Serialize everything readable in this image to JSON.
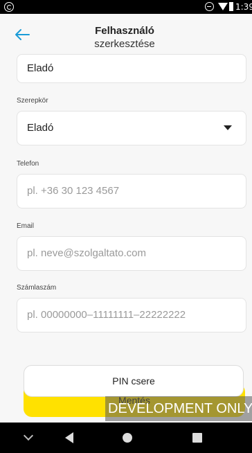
{
  "status_bar": {
    "time": "1:39",
    "icons": [
      "sync-icon",
      "do-not-disturb-icon",
      "wifi-icon",
      "battery-icon"
    ]
  },
  "header": {
    "title_line1": "Felhasználó",
    "title_line2": "szerkesztése",
    "back_icon": "arrow-left-icon",
    "accent_color": "#1a9bd7"
  },
  "form": {
    "name_value": "Eladó",
    "role": {
      "label": "Szerepkör",
      "value": "Eladó"
    },
    "phone": {
      "label": "Telefon",
      "placeholder": "pl. +36 30 123 4567"
    },
    "email": {
      "label": "Email",
      "placeholder": "pl. neve@szolgaltato.com"
    },
    "account": {
      "label": "Számlaszám",
      "placeholder": "pl. 00000000–11111111–22222222"
    }
  },
  "buttons": {
    "pin_change": "PIN csere",
    "save": "Mentés",
    "save_color": "#ffe100"
  },
  "dev_banner": "DEVELOPMENT ONLY",
  "nav": {
    "icons": [
      "chevron-down-icon",
      "back-triangle-icon",
      "home-circle-icon",
      "recents-square-icon"
    ]
  }
}
